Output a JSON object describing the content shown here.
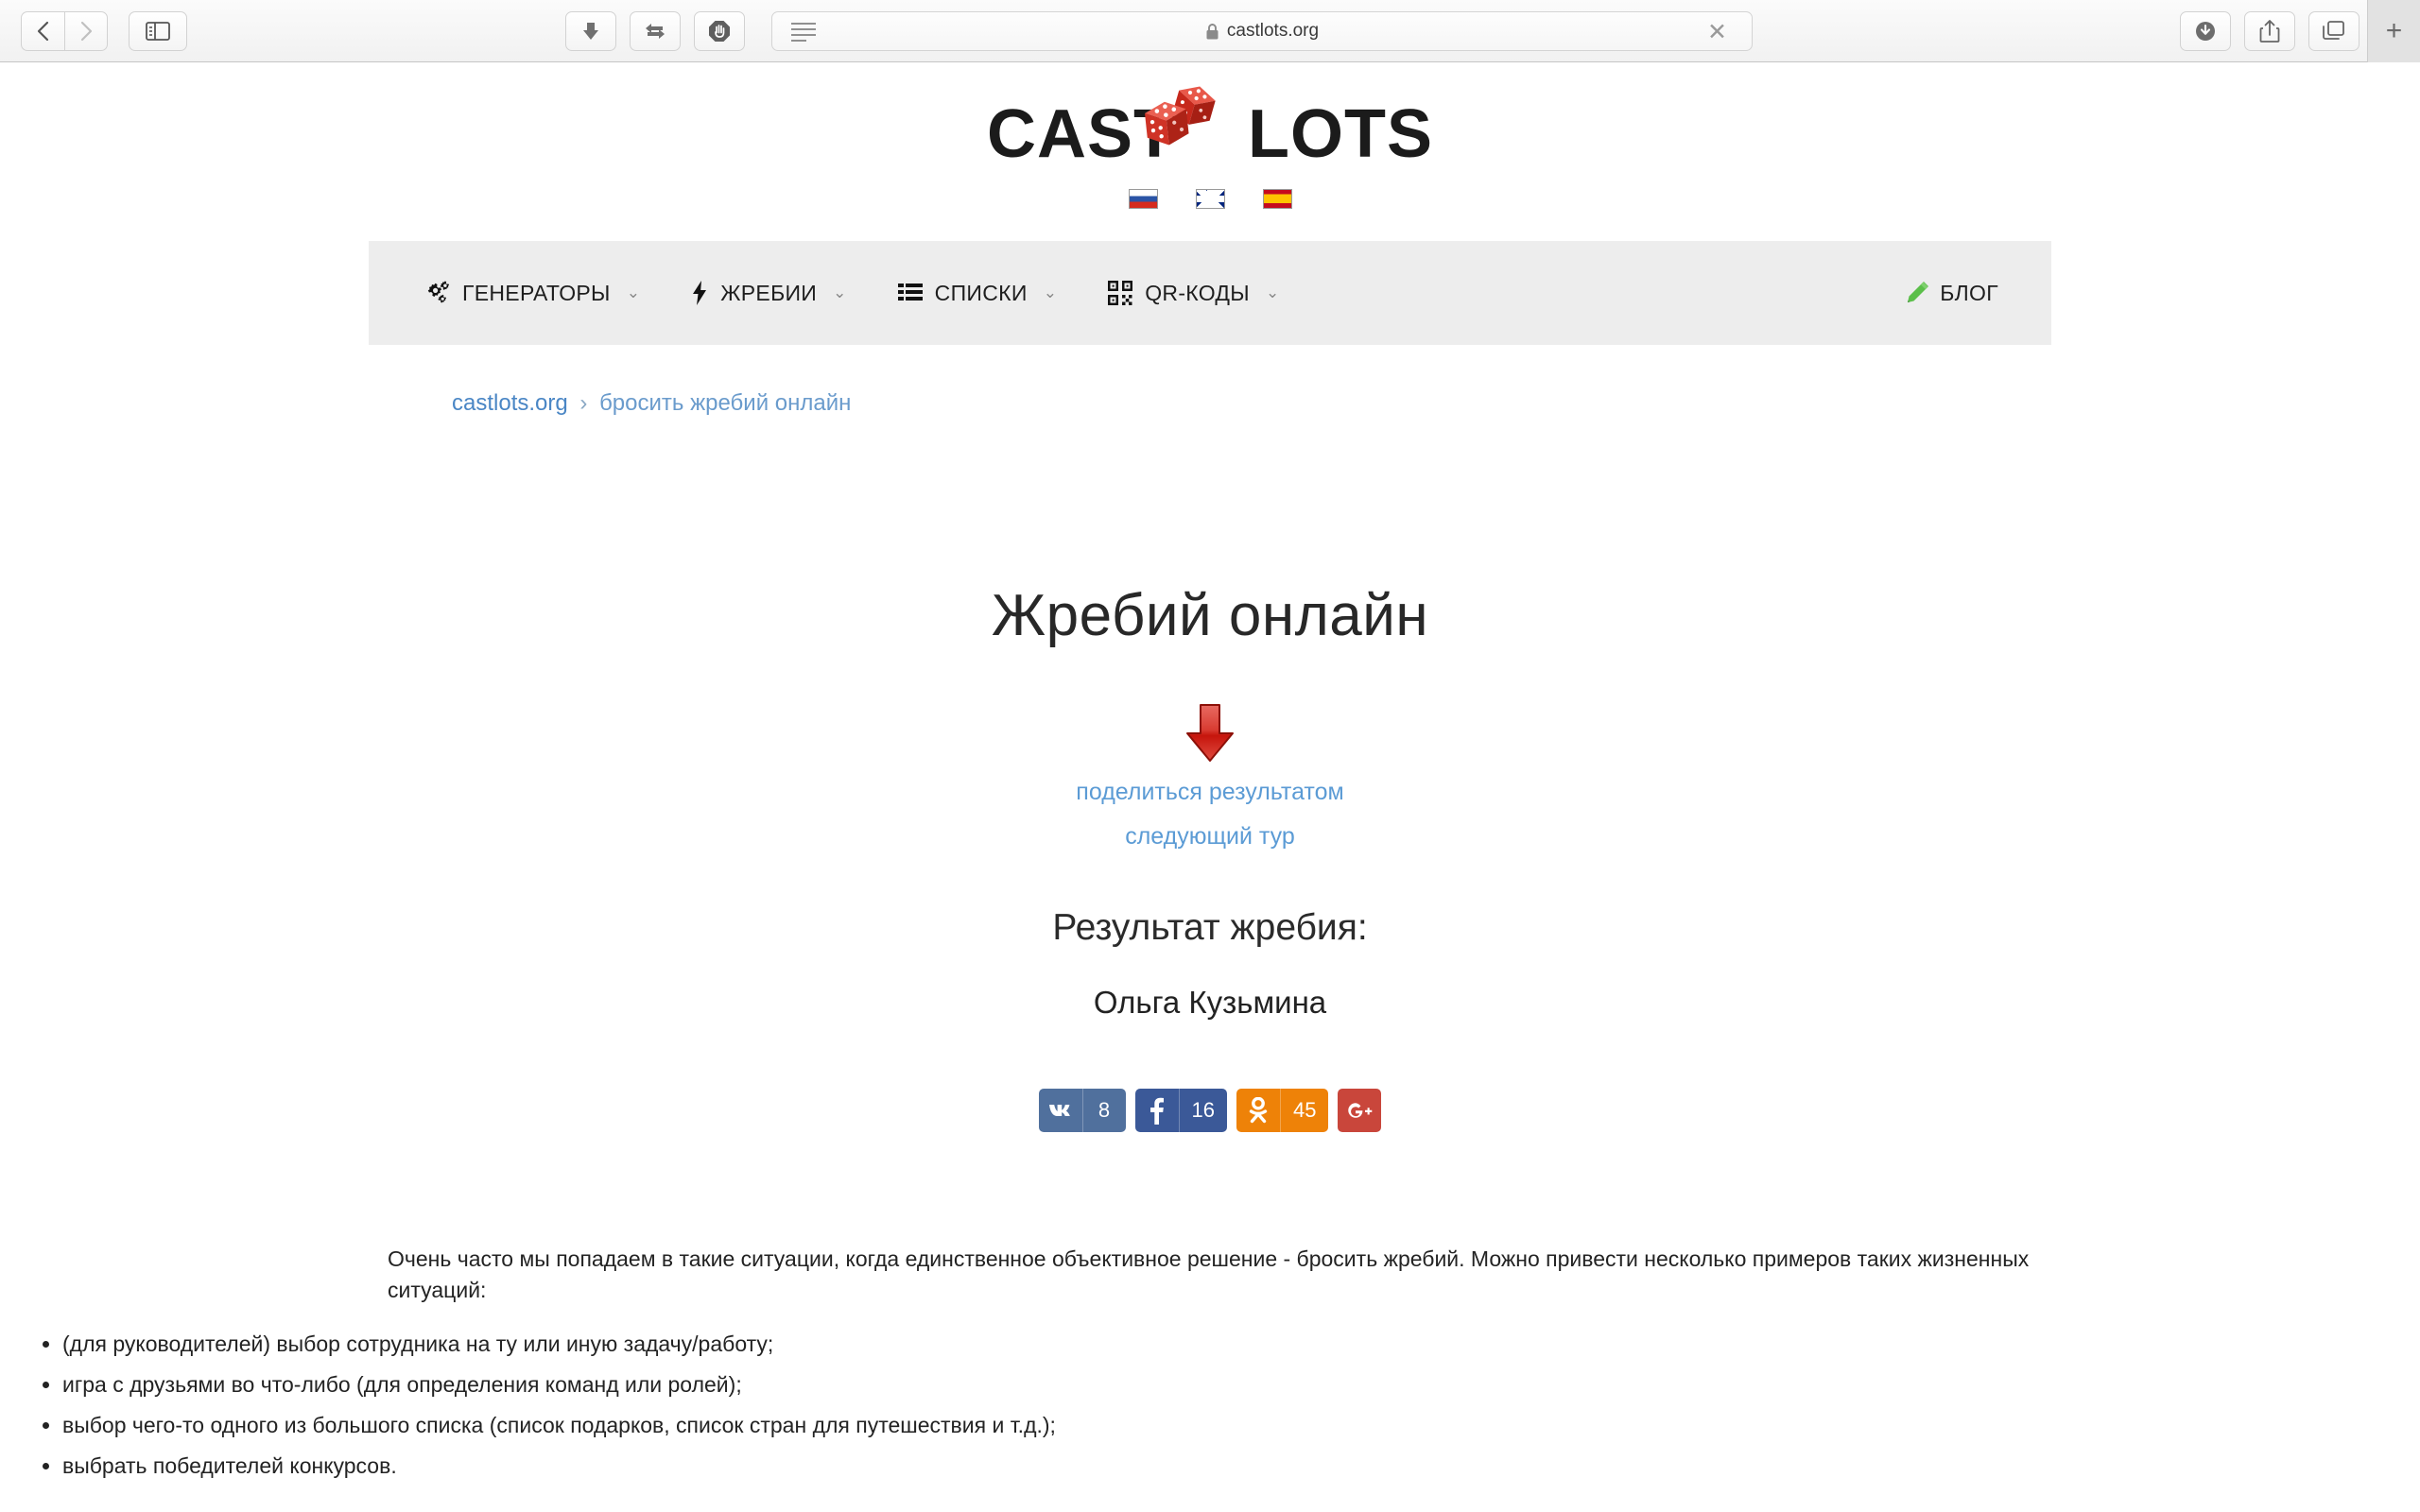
{
  "browser": {
    "back_icon": "chevron-left-icon",
    "forward_icon": "chevron-right-icon",
    "sidebar_icon": "sidebar-toggle-icon",
    "download_arrow_icon": "download-arrow-icon",
    "transfer_icon": "transfer-arrows-icon",
    "adblock_icon": "adblock-stop-hand-icon",
    "reader_icon": "reader-mode-icon",
    "url": "castlots.org",
    "lock_icon": "lock-icon",
    "clear_icon": "clear-x-icon",
    "downloads_icon": "downloads-icon",
    "share_icon": "share-icon",
    "tabs_icon": "tab-overview-icon",
    "newtab_label": "+"
  },
  "site": {
    "logo_left": "CAST",
    "logo_right": "LOTS",
    "logo_dice": "red-dice"
  },
  "languages": [
    {
      "code": "ru",
      "name": "russian-flag"
    },
    {
      "code": "gb",
      "name": "uk-flag"
    },
    {
      "code": "es",
      "name": "spanish-flag"
    }
  ],
  "nav": {
    "items": [
      {
        "label": "ГЕНЕРАТОРЫ",
        "icon": "gears-icon",
        "caret": "⌄"
      },
      {
        "label": "ЖРЕБИИ",
        "icon": "bolt-icon",
        "caret": "⌄"
      },
      {
        "label": "СПИСКИ",
        "icon": "list-icon",
        "caret": "⌄"
      },
      {
        "label": "QR-КОДЫ",
        "icon": "qr-code-icon",
        "caret": "⌄"
      }
    ],
    "blog": {
      "label": "БЛОГ",
      "icon": "pencil-icon"
    }
  },
  "breadcrumb": {
    "home": "castlots.org",
    "separator": "›",
    "current": "бросить жребий онлайн"
  },
  "main": {
    "title": "Жребий онлайн",
    "arrow_icon": "red-down-arrow-icon",
    "share_result_link": "поделиться результатом",
    "next_round_link": "следующий тур",
    "result_label": "Результат жребия:",
    "result_value": "Ольга Кузьмина"
  },
  "social": [
    {
      "network": "vk",
      "icon": "vk-icon",
      "count": "8",
      "color": "#50709d"
    },
    {
      "network": "facebook",
      "icon": "facebook-icon",
      "count": "16",
      "color": "#3b5998"
    },
    {
      "network": "odnoklassniki",
      "icon": "odnoklassniki-icon",
      "count": "45",
      "color": "#ee8208"
    },
    {
      "network": "googleplus",
      "icon": "google-plus-icon",
      "count": "",
      "color": "#c9463b"
    }
  ],
  "article": {
    "intro": "Очень часто мы попадаем в такие ситуации, когда единственное объективное решение - бросить жребий. Можно привести несколько примеров таких жизненных ситуаций:",
    "bullets": [
      "(для руководителей) выбор сотрудника на ту или иную задачу/работу;",
      "игра с друзьями во что-либо (для определения команд или ролей);",
      "выбор чего-то одного из большого списка (список подарков, список стран для путешествия и т.д.);",
      "выбрать победителей конкурсов."
    ]
  }
}
